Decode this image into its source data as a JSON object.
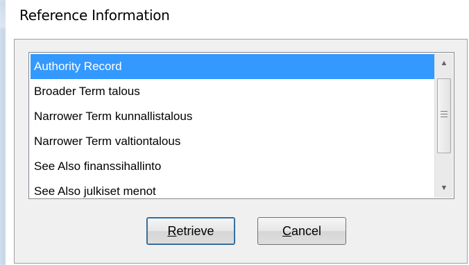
{
  "dialog": {
    "title": "Reference Information"
  },
  "list": {
    "items": [
      {
        "label": "Authority Record",
        "selected": true
      },
      {
        "label": "Broader Term talous",
        "selected": false
      },
      {
        "label": "Narrower Term kunnallistalous",
        "selected": false
      },
      {
        "label": "Narrower Term valtiontalous",
        "selected": false
      },
      {
        "label": "See Also finanssihallinto",
        "selected": false
      },
      {
        "label": "See Also julkiset menot",
        "selected": false
      }
    ],
    "scrollbar": {
      "up_icon": "triangle-up",
      "down_icon": "triangle-down"
    }
  },
  "buttons": {
    "retrieve": {
      "accel": "R",
      "rest": "etrieve"
    },
    "cancel": {
      "accel": "C",
      "rest": "ancel"
    }
  },
  "colors": {
    "selection": "#3399ff",
    "panel": "#f0f0f0"
  }
}
